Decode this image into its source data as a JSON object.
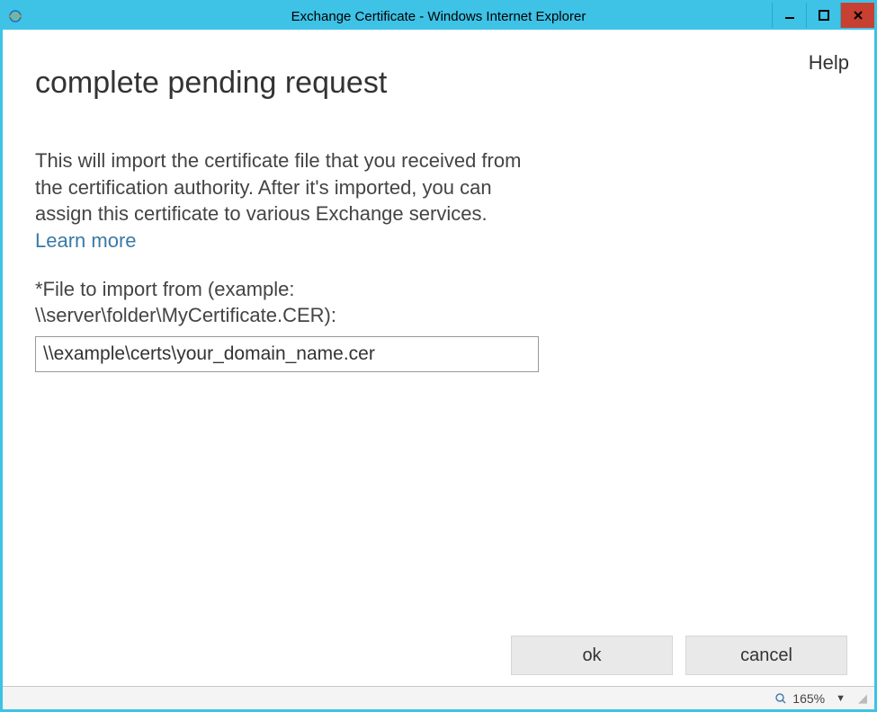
{
  "window": {
    "title": "Exchange Certificate - Windows Internet Explorer"
  },
  "header": {
    "help_label": "Help"
  },
  "page": {
    "title": "complete pending request",
    "description": "This will import the certificate file that you received from the certification authority. After it's imported, you can assign this certificate to various Exchange services. ",
    "learn_more_label": "Learn more ",
    "file_label": "*File to import from (example: \\\\server\\folder\\MyCertificate.CER):",
    "file_value": "\\\\example\\certs\\your_domain_name.cer"
  },
  "buttons": {
    "ok": "ok",
    "cancel": "cancel"
  },
  "statusbar": {
    "zoom": "165%"
  }
}
